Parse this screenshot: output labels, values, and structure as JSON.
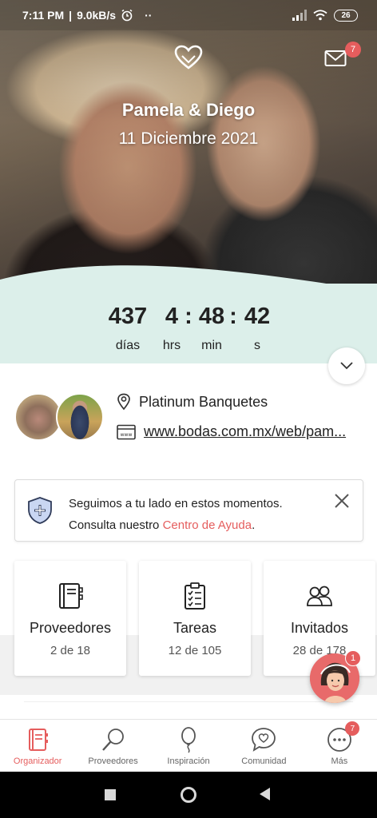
{
  "status_bar": {
    "time": "7:11 PM",
    "speed": "9.0kB/s",
    "dots": "··",
    "battery": "26"
  },
  "hero": {
    "couple_names": "Pamela & Diego",
    "wedding_date": "11 Diciembre 2021",
    "mail_badge": "7"
  },
  "countdown": {
    "days": "437",
    "hours": "4",
    "minutes": "48",
    "seconds": "42",
    "sep1": ":",
    "sep2": ":",
    "days_label": "días",
    "hours_label": "hrs",
    "minutes_label": "min",
    "seconds_label": "s"
  },
  "info": {
    "venue": "Platinum Banquetes",
    "website": "www.bodas.com.mx/web/pam..."
  },
  "help_banner": {
    "line1": "Seguimos a tu lado en estos momentos.",
    "line2_prefix": "Consulta nuestro ",
    "link": "Centro de Ayuda",
    "line2_suffix": "."
  },
  "cards": [
    {
      "title": "Proveedores",
      "sub": "2 de 18"
    },
    {
      "title": "Tareas",
      "sub": "12 de 105"
    },
    {
      "title": "Invitados",
      "sub": "28 de 178"
    }
  ],
  "helper": {
    "badge": "1"
  },
  "bottom_nav": [
    {
      "label": "Organizador",
      "icon": "organizer-icon",
      "active": true
    },
    {
      "label": "Proveedores",
      "icon": "search-icon",
      "active": false
    },
    {
      "label": "Inspiración",
      "icon": "balloon-icon",
      "active": false
    },
    {
      "label": "Comunidad",
      "icon": "chat-heart-icon",
      "active": false
    },
    {
      "label": "Más",
      "icon": "more-icon",
      "active": false,
      "badge": "7"
    }
  ],
  "colors": {
    "accent": "#e55d5d",
    "countdown_bg": "#dcefea"
  }
}
